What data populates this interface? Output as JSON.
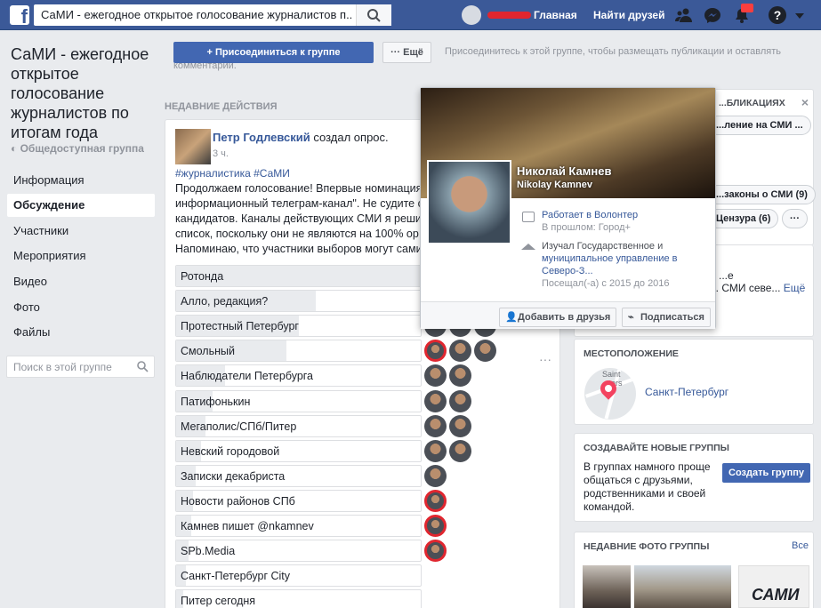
{
  "topbar": {
    "search_value": "СаМИ - ежегодное открытое голосование журналистов п...",
    "home": "Главная",
    "find_friends": "Найти друзей"
  },
  "sidebar": {
    "title": "СаМИ - ежегодное открытое голосование журналистов по итогам года",
    "type": "Общедоступная группа",
    "items": [
      {
        "label": "Информация"
      },
      {
        "label": "Обсуждение"
      },
      {
        "label": "Участники"
      },
      {
        "label": "Мероприятия"
      },
      {
        "label": "Видео"
      },
      {
        "label": "Фото"
      },
      {
        "label": "Файлы"
      }
    ],
    "search_placeholder": "Поиск в этой группе"
  },
  "join": {
    "join_label": "Присоединиться к группе",
    "more_label": "Ещё",
    "note": "Присоединитесь к этой группе, чтобы размещать публикации и оставлять комментарии."
  },
  "recent": {
    "heading": "НЕДАВНИЕ ДЕЙСТВИЯ"
  },
  "post": {
    "author": "Петр Годлевский",
    "action": " создал опрос.",
    "time": "3 ч.",
    "hashtags": "#журналистика #СаМИ",
    "text": "Продолжаем голосование! Впервые номинация информационный телеграм-канал\". Не судите с кандидатов. Каналы действующих СМИ я реши список, поскольку они не являются на 100% ор Напоминаю, что участники выборов могут сами",
    "lines": [
      "Продолжаем голосование! Впервые номинация",
      "информационный телеграм-канал\". Не судите с",
      "кандидатов. Каналы действующих СМИ я реши",
      "список, поскольку они не являются на 100% ор",
      "Напоминаю, что участники выборов могут сами"
    ],
    "options": [
      {
        "label": "Ротонда",
        "share": 1.0
      },
      {
        "label": "Алло, редакция?",
        "share": 0.57
      },
      {
        "label": "Протестный Петербург",
        "share": 0.5
      },
      {
        "label": "Смольный",
        "share": 0.45
      },
      {
        "label": "Наблюдатели Петербурга",
        "share": 0.2
      },
      {
        "label": "Патифонькин",
        "share": 0.15
      },
      {
        "label": "Мегаполис/СПб/Питер",
        "share": 0.12
      },
      {
        "label": "Невский городовой",
        "share": 0.1
      },
      {
        "label": "Записки декабриста",
        "share": 0.08
      },
      {
        "label": "Новости районов СПб",
        "share": 0.07
      },
      {
        "label": "Камнев пишет @nkamnev",
        "share": 0.06
      },
      {
        "label": "SPb.Media",
        "share": 0.05
      },
      {
        "label": "Санкт-Петербург City",
        "share": 0.04
      },
      {
        "label": "Питер сегодня",
        "share": 0.03
      }
    ]
  },
  "hovercard": {
    "name": "Николай Камнев",
    "name_latin": "Nikolay Kamnev",
    "work": "Работает в Волонтер",
    "work_sub": "В прошлом: Город+",
    "study": "Изучал Государственное и муниципальное управление в Северо-З...",
    "study_l1": "Изучал Государственное и",
    "study_l2": "муниципальное управление в",
    "study_l3": "Северо-З...",
    "study_sub": "Посещал(-а) с 2015 до 2016",
    "add_friend": "Добавить в друзья",
    "subscribe": "Подписаться"
  },
  "right": {
    "card1_title": "...БЛИКАЦИЯХ",
    "chip1": "...ление на СМИ ...",
    "chip2": "...законы о СМИ (9)",
    "chip3": "Цензура (6)",
    "desc_l1": "...е",
    "desc_l2": "... СМИ севе...",
    "desc_more": "Ещё",
    "location_h": "МЕСТОПОЛОЖЕНИЕ",
    "city": "Санкт-Петербург",
    "map_text": "Saint ...ters",
    "create_h": "СОЗДАВАЙТЕ НОВЫЕ ГРУППЫ",
    "create_text": "В группах намного проще общаться с друзьями, родственниками и своей командой.",
    "create_l1": "В группах намного проще",
    "create_l2": "общаться с друзьями,",
    "create_l3": "родственниками и своей",
    "create_l4": "командой.",
    "create_btn": "Создать группу",
    "photos_h": "НЕДАВНИЕ ФОТО ГРУППЫ",
    "photos_all": "Все",
    "thumb_text": "САМИ"
  },
  "colors": {
    "brand": "#3b5998",
    "button": "#4267b2",
    "link": "#365899",
    "alert": "#e0262f"
  },
  "icons": [
    "facebook-logo-icon",
    "search-icon",
    "friends-icon",
    "messenger-icon",
    "notifications-icon",
    "help-icon",
    "dropdown-caret-icon",
    "globe-icon",
    "plus-icon",
    "work-icon",
    "education-icon",
    "add-friend-icon",
    "rss-icon",
    "close-icon",
    "map-pin-icon"
  ]
}
